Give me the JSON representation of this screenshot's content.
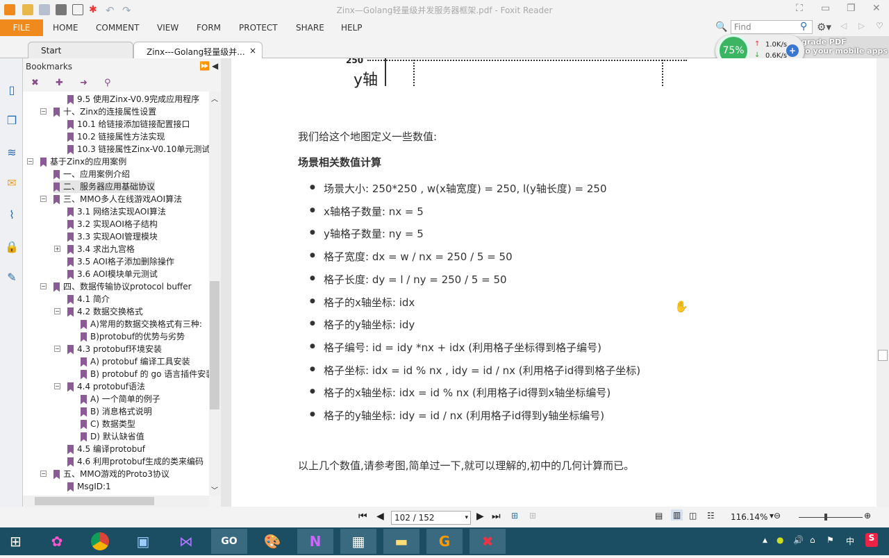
{
  "window": {
    "title": "Zinx—Golang轻量级并发服务器框架.pdf - Foxit Reader"
  },
  "ribbon": {
    "tabs": [
      "FILE",
      "HOME",
      "COMMENT",
      "VIEW",
      "FORM",
      "PROTECT",
      "SHARE",
      "HELP"
    ],
    "find_placeholder": "Find"
  },
  "doc_tabs": [
    {
      "label": "Start"
    },
    {
      "label": "Zinx---Golang轻量级并...",
      "close": "×"
    }
  ],
  "promo": {
    "text1": "grade PDF",
    "text2": "to your mobile apps"
  },
  "net_widget": {
    "percent": "75%",
    "up": "1.0K/s",
    "down": "0.6K/s"
  },
  "bookmarks": {
    "title": "Bookmarks",
    "items": [
      {
        "label": "9.5 使用Zinx-V0.9完成应用程序",
        "level": 3
      },
      {
        "label": "十、Zinx的连接属性设置",
        "level": 2,
        "toggle": "-"
      },
      {
        "label": "10.1 给链接添加链接配置接口",
        "level": 3
      },
      {
        "label": "10.2 链接属性方法实现",
        "level": 3
      },
      {
        "label": "10.3 链接属性Zinx-V0.10单元测试",
        "level": 3
      },
      {
        "label": "基于Zinx的应用案例",
        "level": 1,
        "toggle": "-"
      },
      {
        "label": "一、应用案例介绍",
        "level": 2
      },
      {
        "label": "二、服务器应用基础协议",
        "level": 2,
        "selected": true
      },
      {
        "label": "三、MMO多人在线游戏AOI算法",
        "level": 2,
        "toggle": "-"
      },
      {
        "label": "3.1 网络法实现AOI算法",
        "level": 3
      },
      {
        "label": "3.2 实现AOI格子结构",
        "level": 3
      },
      {
        "label": "3.3 实现AOI管理模块",
        "level": 3
      },
      {
        "label": "3.4 求出九宫格",
        "level": 3,
        "toggle": "+"
      },
      {
        "label": "3.5 AOI格子添加删除操作",
        "level": 3
      },
      {
        "label": "3.6 AOI模块单元测试",
        "level": 3
      },
      {
        "label": "四、数据传输协议protocol buffer",
        "level": 2,
        "toggle": "-"
      },
      {
        "label": "4.1 简介",
        "level": 3
      },
      {
        "label": "4.2 数据交换格式",
        "level": 3,
        "toggle": "-"
      },
      {
        "label": "A)常用的数据交换格式有三种:",
        "level": 4
      },
      {
        "label": "B)protobuf的优势与劣势",
        "level": 4
      },
      {
        "label": "4.3 protobuf环境安装",
        "level": 3,
        "toggle": "-"
      },
      {
        "label": "A) protobuf 编译工具安装",
        "level": 4
      },
      {
        "label": "B) protobuf 的 go 语言插件安装",
        "level": 4
      },
      {
        "label": "4.4 protobuf语法",
        "level": 3,
        "toggle": "-"
      },
      {
        "label": "A) 一个简单的例子",
        "level": 4
      },
      {
        "label": "B) 消息格式说明",
        "level": 4
      },
      {
        "label": "C) 数据类型",
        "level": 4
      },
      {
        "label": "D) 默认缺省值",
        "level": 4
      },
      {
        "label": "4.5 编译protobuf",
        "level": 3
      },
      {
        "label": "4.6 利用protobuf生成的类来编码",
        "level": 3
      },
      {
        "label": "五、MMO游戏的Proto3协议",
        "level": 2,
        "toggle": "-"
      },
      {
        "label": "MsgID:1",
        "level": 3
      }
    ]
  },
  "document": {
    "figure": {
      "tick": "250",
      "axis_label": "y轴"
    },
    "intro": "我们给这个地图定义一些数值:",
    "heading": "场景相关数值计算",
    "bullets": [
      "场景大小:  250*250 ,  w(x轴宽度) = 250, l(y轴长度) = 250",
      "x轴格子数量: nx = 5",
      "y轴格子数量: ny = 5",
      "格子宽度: dx = w / nx = 250 / 5 = 50",
      "格子长度: dy = l / ny = 250 / 5 = 50",
      "格子的x轴坐标: idx",
      "格子的y轴坐标: idy",
      "格子编号: id = idy *nx + idx (利用格子坐标得到格子编号)",
      "格子坐标: idx = id % nx , idy = id / nx (利用格子id得到格子坐标)",
      "格子的x轴坐标: idx = id % nx (利用格子id得到x轴坐标编号)",
      "格子的y轴坐标: idy = id / nx (利用格子id得到y轴坐标编号)"
    ],
    "outro": "以上几个数值,请参考图,简单过一下,就可以理解的,初中的几何计算而已。"
  },
  "statusbar": {
    "page": "102 / 152",
    "zoom": "116.14%",
    "zoom_slider_fraction": 0.4
  },
  "tray": {
    "ime": "中"
  },
  "colors": {
    "accent": "#f08a1c",
    "bookmark": "#8a5b94",
    "taskbar": "#1c4e63"
  }
}
